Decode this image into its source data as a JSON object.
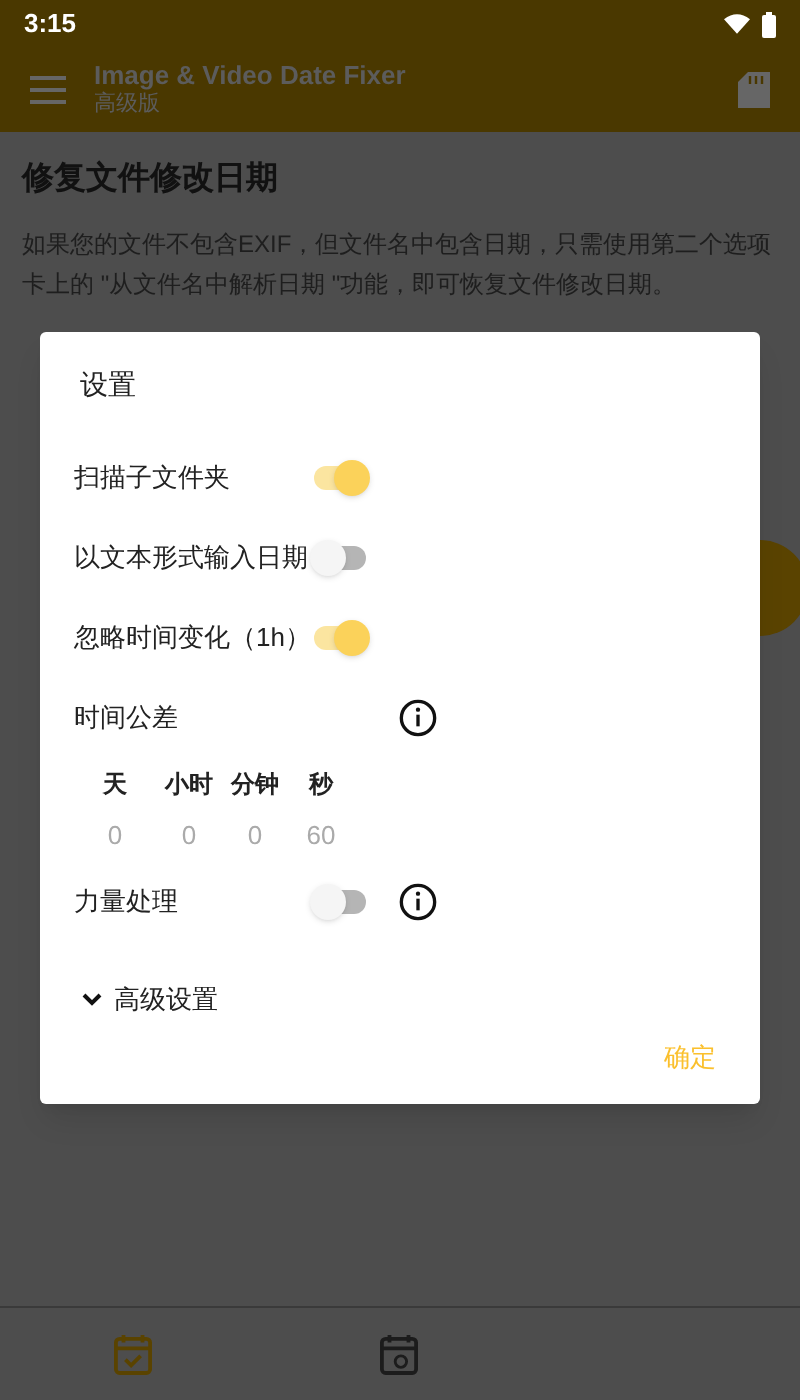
{
  "status_bar": {
    "time": "3:15"
  },
  "app_bar": {
    "title": "Image & Video Date Fixer",
    "subtitle": "高级版"
  },
  "page": {
    "heading": "修复文件修改日期",
    "description": "如果您的文件不包含EXIF，但文件名中包含日期，只需使用第二个选项卡上的 \"从文件名中解析日期 \"功能，即可恢复文件修改日期。"
  },
  "dialog": {
    "title": "设置",
    "items": [
      {
        "kind": "toggle",
        "label": "扫描子文件夹",
        "on": true,
        "info": false
      },
      {
        "kind": "toggle",
        "label": "以文本形式输入日期",
        "on": false,
        "info": false
      },
      {
        "kind": "toggle",
        "label": "忽略时间变化（1h）",
        "on": true,
        "info": false
      },
      {
        "kind": "tolerance",
        "label": "时间公差",
        "units": [
          {
            "label": "天",
            "value": "0"
          },
          {
            "label": "小时",
            "value": "0"
          },
          {
            "label": "分钟",
            "value": "0"
          },
          {
            "label": "秒",
            "value": "60"
          }
        ]
      },
      {
        "kind": "toggle",
        "label": "力量处理",
        "on": false,
        "info": true
      },
      {
        "kind": "expander",
        "label": "高级设置",
        "expanded": false
      }
    ],
    "confirm": "确定"
  },
  "bottom_nav": [
    {
      "selected": true
    },
    {
      "selected": false
    }
  ]
}
